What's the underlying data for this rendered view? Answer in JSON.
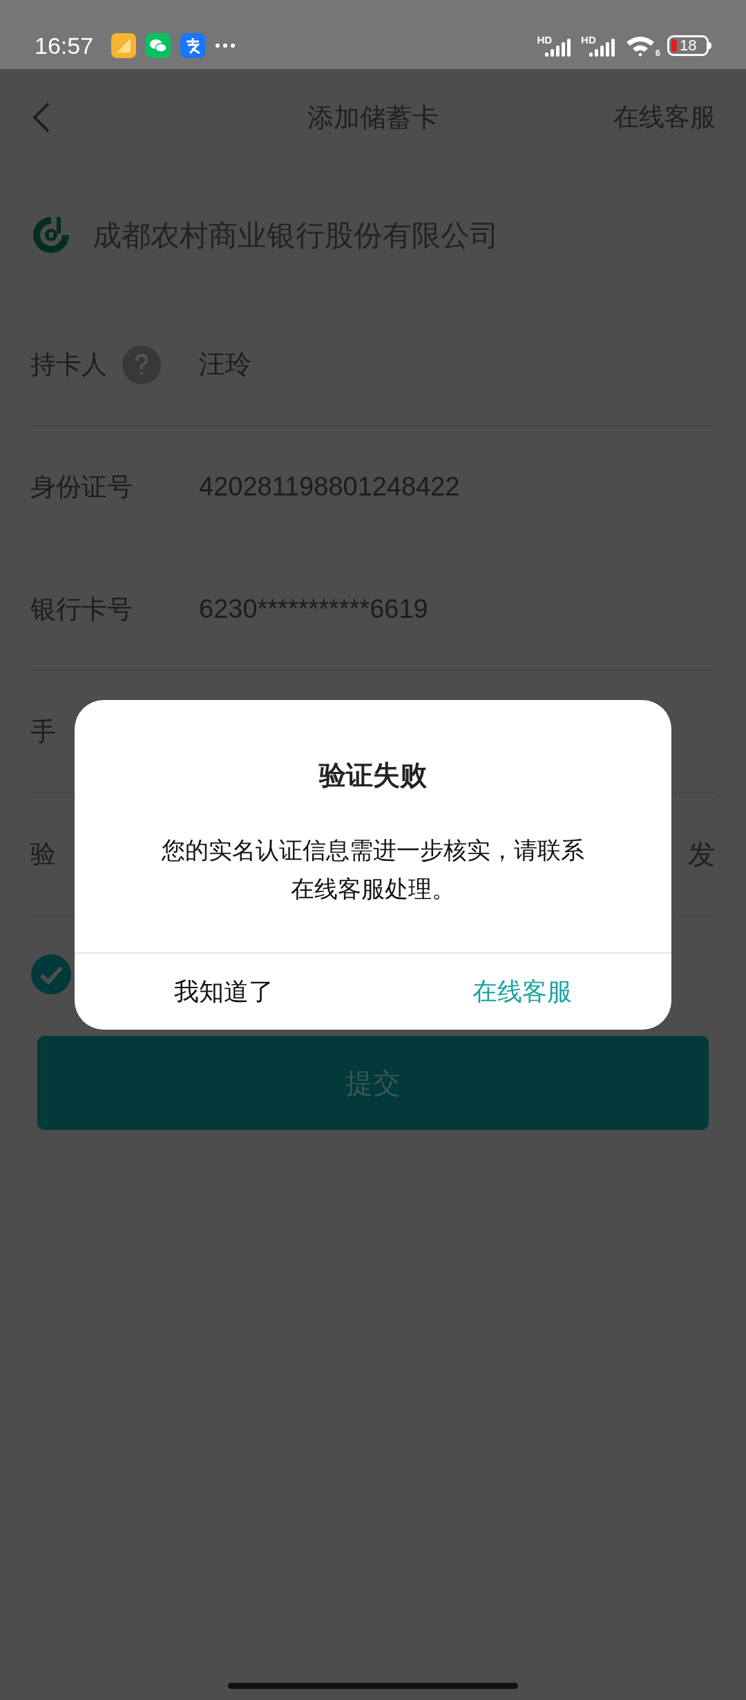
{
  "status_bar": {
    "time": "16:57",
    "signals": [
      {
        "label": "HD"
      },
      {
        "label": "HD"
      }
    ],
    "wifi_label": "6",
    "battery": "18"
  },
  "nav": {
    "title": "添加储蓄卡",
    "action": "在线客服"
  },
  "bank": {
    "name": "成都农村商业银行股份有限公司"
  },
  "rows": [
    {
      "label": "持卡人",
      "help": true,
      "value": "汪玲"
    },
    {
      "label": "身份证号",
      "help": false,
      "value": "420281198801248422"
    },
    {
      "label": "银行卡号",
      "help": false,
      "value": "6230***********6619"
    },
    {
      "label": "手",
      "help": false
    },
    {
      "label": "验",
      "help": false,
      "action": "发"
    }
  ],
  "agreement": {
    "checked": true
  },
  "submit": {
    "label": "提交"
  },
  "dialog": {
    "title": "验证失败",
    "message": "您的实名认证信息需进一步核实，请联系在线客服处理。",
    "buttons": [
      {
        "label": "我知道了",
        "kind": "plain"
      },
      {
        "label": "在线客服",
        "kind": "accent"
      }
    ]
  }
}
